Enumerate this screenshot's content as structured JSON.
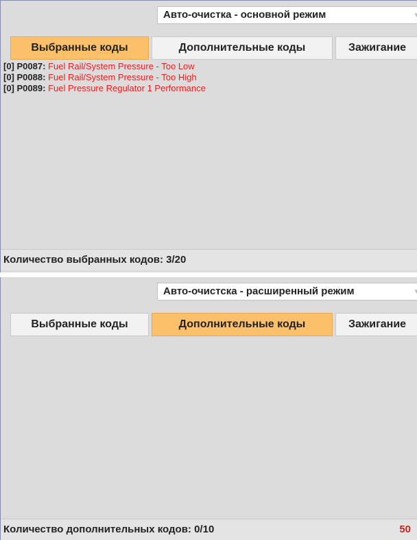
{
  "panel1": {
    "mode_label": "Авто-очистка - основной режим",
    "tabs": [
      {
        "label": "Выбранные коды",
        "active": true
      },
      {
        "label": "Дополнительные коды",
        "active": false
      },
      {
        "label": "Зажигание",
        "active": false
      }
    ],
    "codes": [
      {
        "index": "[0]",
        "code": "P0087:",
        "description": "Fuel Rail/System Pressure - Too Low"
      },
      {
        "index": "[0]",
        "code": "P0088:",
        "description": "Fuel Rail/System Pressure - Too High"
      },
      {
        "index": "[0]",
        "code": "P0089:",
        "description": "Fuel Pressure Regulator 1 Performance"
      }
    ],
    "status_label": "Количество выбранных кодов: 3/20"
  },
  "panel2": {
    "mode_label": "Авто-очистска - расширенный режим",
    "tabs": [
      {
        "label": "Выбранные коды",
        "active": false
      },
      {
        "label": "Дополнительные коды",
        "active": true
      },
      {
        "label": "Зажигание",
        "active": false
      }
    ],
    "codes": [],
    "status_label": "Количество дополнительных кодов: 0/10",
    "status_number": "50"
  },
  "colors": {
    "active_tab": "#fcc06a",
    "code_description": "#ee1c1c",
    "status_number": "#c0281d"
  },
  "icons": {
    "dropdown": "chevron-down-icon"
  }
}
